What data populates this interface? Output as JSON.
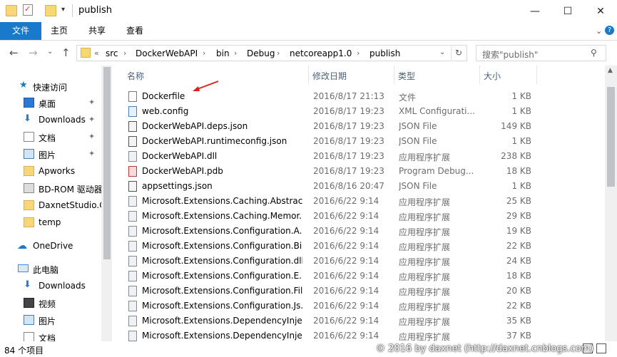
{
  "window": {
    "title": "publish",
    "controls": {
      "minimize": "—",
      "maximize": "☐",
      "close": "✕"
    }
  },
  "ribbon": {
    "tabs": [
      "文件",
      "主页",
      "共享",
      "查看"
    ],
    "active_tab_color": "#1979ca"
  },
  "address": {
    "prefix": "«",
    "crumbs": [
      "src",
      "DockerWebAPI",
      "bin",
      "Debug",
      "netcoreapp1.0",
      "publish"
    ],
    "search_placeholder": "搜索\"publish\""
  },
  "nav": {
    "quick_access": "快速访问",
    "quick_items": [
      {
        "label": "桌面",
        "icon": "desktop-icon",
        "pinned": true
      },
      {
        "label": "Downloads",
        "icon": "download-icon",
        "pinned": true
      },
      {
        "label": "文档",
        "icon": "document-icon",
        "pinned": true
      },
      {
        "label": "图片",
        "icon": "picture-icon",
        "pinned": true
      },
      {
        "label": "Apworks",
        "icon": "folder-icon",
        "pinned": false
      },
      {
        "label": "BD-ROM 驱动器",
        "icon": "drive-icon",
        "pinned": false
      },
      {
        "label": "DaxnetStudio.C",
        "icon": "folder-icon",
        "pinned": false
      },
      {
        "label": "temp",
        "icon": "folder-icon",
        "pinned": false
      }
    ],
    "onedrive": "OneDrive",
    "this_pc": "此电脑",
    "pc_items": [
      {
        "label": "Downloads",
        "icon": "download-icon"
      },
      {
        "label": "视频",
        "icon": "video-icon"
      },
      {
        "label": "图片",
        "icon": "picture-icon"
      },
      {
        "label": "文档",
        "icon": "document-icon"
      }
    ]
  },
  "columns": {
    "name": "名称",
    "date": "修改日期",
    "type": "类型",
    "size": "大小"
  },
  "files": [
    {
      "name": "Dockerfile",
      "date": "2016/8/17 21:13",
      "type": "文件",
      "size": "1 KB",
      "icon": "file-icon"
    },
    {
      "name": "web.config",
      "date": "2016/8/17 19:23",
      "type": "XML Configurati...",
      "size": "1 KB",
      "icon": "config-file-icon"
    },
    {
      "name": "DockerWebAPI.deps.json",
      "date": "2016/8/17 19:23",
      "type": "JSON File",
      "size": "149 KB",
      "icon": "json-file-icon"
    },
    {
      "name": "DockerWebAPI.runtimeconfig.json",
      "date": "2016/8/17 19:23",
      "type": "JSON File",
      "size": "1 KB",
      "icon": "json-file-icon"
    },
    {
      "name": "DockerWebAPI.dll",
      "date": "2016/8/17 19:23",
      "type": "应用程序扩展",
      "size": "238 KB",
      "icon": "dll-file-icon"
    },
    {
      "name": "DockerWebAPI.pdb",
      "date": "2016/8/17 19:23",
      "type": "Program Debug...",
      "size": "18 KB",
      "icon": "pdb-file-icon"
    },
    {
      "name": "appsettings.json",
      "date": "2016/8/16 20:47",
      "type": "JSON File",
      "size": "1 KB",
      "icon": "json-file-icon"
    },
    {
      "name": "Microsoft.Extensions.Caching.Abstrac...",
      "date": "2016/6/22 9:14",
      "type": "应用程序扩展",
      "size": "25 KB",
      "icon": "dll-file-icon"
    },
    {
      "name": "Microsoft.Extensions.Caching.Memor...",
      "date": "2016/6/22 9:14",
      "type": "应用程序扩展",
      "size": "29 KB",
      "icon": "dll-file-icon"
    },
    {
      "name": "Microsoft.Extensions.Configuration.A...",
      "date": "2016/6/22 9:14",
      "type": "应用程序扩展",
      "size": "19 KB",
      "icon": "dll-file-icon"
    },
    {
      "name": "Microsoft.Extensions.Configuration.Bi...",
      "date": "2016/6/22 9:14",
      "type": "应用程序扩展",
      "size": "22 KB",
      "icon": "dll-file-icon"
    },
    {
      "name": "Microsoft.Extensions.Configuration.dll",
      "date": "2016/6/22 9:14",
      "type": "应用程序扩展",
      "size": "24 KB",
      "icon": "dll-file-icon"
    },
    {
      "name": "Microsoft.Extensions.Configuration.E...",
      "date": "2016/6/22 9:14",
      "type": "应用程序扩展",
      "size": "18 KB",
      "icon": "dll-file-icon"
    },
    {
      "name": "Microsoft.Extensions.Configuration.Fil...",
      "date": "2016/6/22 9:14",
      "type": "应用程序扩展",
      "size": "20 KB",
      "icon": "dll-file-icon"
    },
    {
      "name": "Microsoft.Extensions.Configuration.Js...",
      "date": "2016/6/22 9:14",
      "type": "应用程序扩展",
      "size": "22 KB",
      "icon": "dll-file-icon"
    },
    {
      "name": "Microsoft.Extensions.DependencyInje...",
      "date": "2016/6/22 9:14",
      "type": "应用程序扩展",
      "size": "35 KB",
      "icon": "dll-file-icon"
    },
    {
      "name": "Microsoft.Extensions.DependencyInje...",
      "date": "2016/6/22 9:14",
      "type": "应用程序扩展",
      "size": "37 KB",
      "icon": "dll-file-icon"
    }
  ],
  "status": {
    "item_count": "84 个项目"
  },
  "watermark": "© 2016 by daxnet (http://daxnet.cnblogs.com)",
  "colors": {
    "accent": "#1979ca",
    "folder": "#f8d775",
    "arrow": "#e02020"
  }
}
